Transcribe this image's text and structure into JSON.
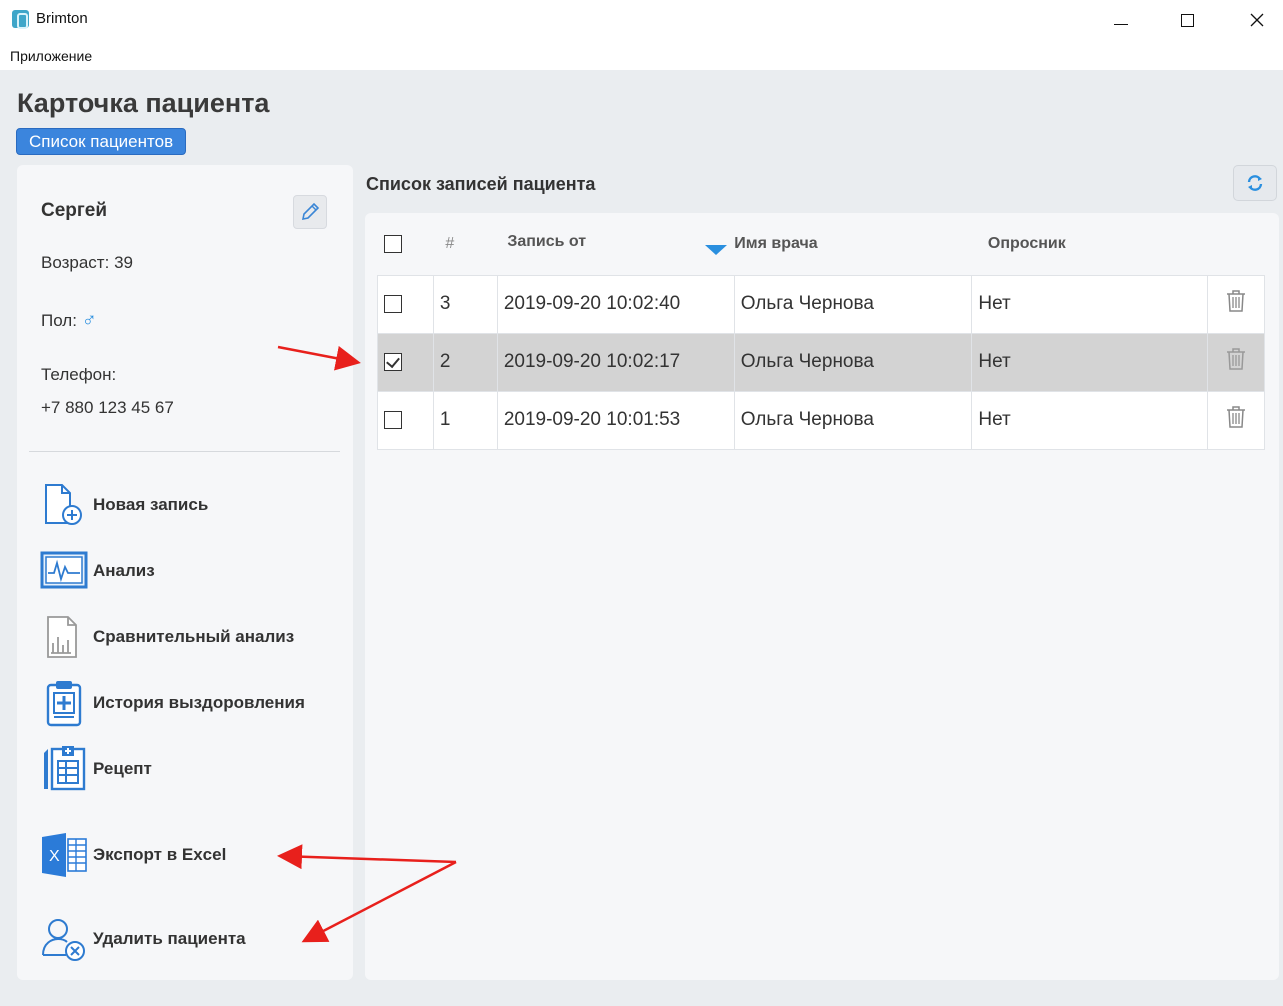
{
  "window": {
    "title": "Brimton",
    "minimize": "minimize",
    "maximize": "maximize",
    "close": "close"
  },
  "menu": {
    "items": [
      {
        "label": "Приложение"
      }
    ]
  },
  "page": {
    "title": "Карточка пациента",
    "back_label": "Список пациентов"
  },
  "patient": {
    "name": "Сергей",
    "age_label": "Возраст:",
    "age_value": "39",
    "gender_label": "Пол:",
    "gender_symbol": "♂",
    "phone_label": "Телефон:",
    "phone_value": "+7 880 123 45 67"
  },
  "actions": [
    {
      "label": "Новая запись",
      "icon": "new-record-icon"
    },
    {
      "label": "Анализ",
      "icon": "analysis-icon"
    },
    {
      "label": "Сравнительный анализ",
      "icon": "comparative-analysis-icon"
    },
    {
      "label": "История выздоровления",
      "icon": "recovery-history-icon"
    },
    {
      "label": "Рецепт",
      "icon": "prescription-icon"
    },
    {
      "label": "Экспорт в Excel",
      "icon": "excel-icon"
    },
    {
      "label": "Удалить пациента",
      "icon": "delete-patient-icon"
    }
  ],
  "records": {
    "title": "Список записей пациента",
    "columns": {
      "num": "#",
      "date": "Запись от",
      "doctor": "Имя врача",
      "survey": "Опросник"
    },
    "rows": [
      {
        "num": "3",
        "date": "2019-09-20 10:02:40",
        "doctor": "Ольга Чернова",
        "survey": "Нет",
        "checked": false
      },
      {
        "num": "2",
        "date": "2019-09-20 10:02:17",
        "doctor": "Ольга Чернова",
        "survey": "Нет",
        "checked": true
      },
      {
        "num": "1",
        "date": "2019-09-20 10:01:53",
        "doctor": "Ольга Чернова",
        "survey": "Нет",
        "checked": false
      }
    ]
  },
  "colors": {
    "accent": "#3b85dd",
    "sort_arrow": "#2a8fdf",
    "annotation": "#e8201c",
    "selected_row": "#d3d3d3"
  }
}
